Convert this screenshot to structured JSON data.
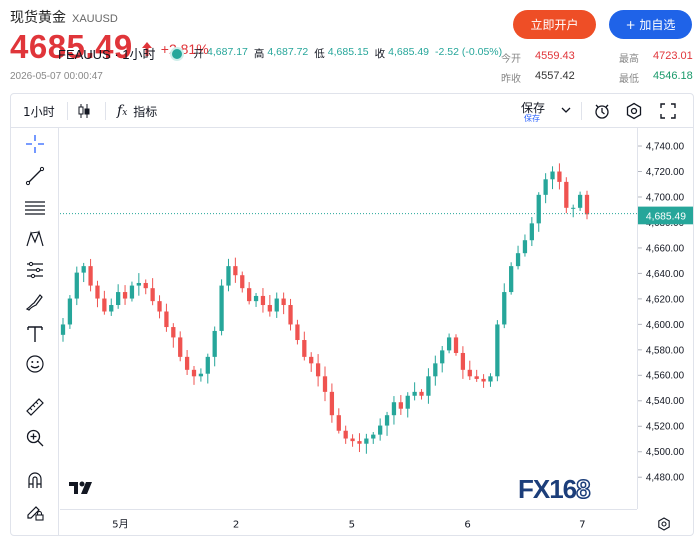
{
  "header": {
    "title": "现货黄金",
    "symbol": "XAUUSD",
    "price": "4685.49",
    "change_pct": "+2.81%",
    "timestamp": "2026-05-07 00:00:47",
    "open_account_label": "立即开户",
    "add_watchlist_label": "+ 加自选",
    "stats": {
      "open_label": "今开",
      "open": "4559.43",
      "prev_close_label": "昨收",
      "prev_close": "4557.42",
      "high_label": "最高",
      "high": "4723.01",
      "low_label": "最低",
      "low": "4546.18"
    }
  },
  "toolbar": {
    "interval": "1小时",
    "indicators_label": "指标",
    "save_label": "保存",
    "save_sub": "保存"
  },
  "left_tools": [
    "crosshair-icon",
    "trend-line-icon",
    "horizontal-lines-icon",
    "pattern-icon",
    "measure-lines-icon",
    "brush-icon",
    "text-icon",
    "emoji-icon",
    "ruler-icon",
    "zoom-in-icon",
    "magnet-icon",
    "lock-pencil-icon"
  ],
  "legend": {
    "symbol": "FEAUUS · 1小时",
    "open_label": "开",
    "open": "4,687.17",
    "high_label": "高",
    "high": "4,687.72",
    "low_label": "低",
    "low": "4,685.15",
    "close_label": "收",
    "close": "4,685.49",
    "change": "-2.52 (-0.05%)"
  },
  "watermark": {
    "brand": "FX16",
    "brand_num": "8"
  },
  "colors": {
    "up": "#26a69a",
    "down": "#ef5350",
    "accent_red": "#e0353a",
    "brand_blue": "#1f63e8",
    "brand_orange": "#ee4e26"
  },
  "chart_data": {
    "type": "candlestick",
    "ylim": [
      4480,
      4740
    ],
    "y_ticks": [
      "4,740.00",
      "4,720.00",
      "4,700.00",
      "4,680.00",
      "4,660.00",
      "4,640.00",
      "4,620.00",
      "4,600.00",
      "4,580.00",
      "4,560.00",
      "4,540.00",
      "4,520.00",
      "4,500.00",
      "4,480.00"
    ],
    "x_ticks": [
      "5月",
      "2",
      "5",
      "6",
      "7"
    ],
    "last_price_label": "4,685.49",
    "last_price": 4685.49,
    "close_series": [
      4600,
      4620,
      4640,
      4645,
      4630,
      4620,
      4610,
      4615,
      4625,
      4620,
      4630,
      4632,
      4628,
      4618,
      4610,
      4598,
      4590,
      4575,
      4565,
      4560,
      4562,
      4575,
      4595,
      4630,
      4645,
      4638,
      4628,
      4618,
      4622,
      4615,
      4610,
      4620,
      4615,
      4600,
      4588,
      4575,
      4570,
      4560,
      4548,
      4530,
      4518,
      4512,
      4510,
      4508,
      4512,
      4515,
      4522,
      4530,
      4540,
      4535,
      4545,
      4548,
      4545,
      4560,
      4570,
      4580,
      4590,
      4578,
      4565,
      4560,
      4558,
      4556,
      4560,
      4600,
      4625,
      4645,
      4655,
      4665,
      4678,
      4700,
      4712,
      4718,
      4710,
      4690,
      4690,
      4700,
      4685
    ]
  }
}
